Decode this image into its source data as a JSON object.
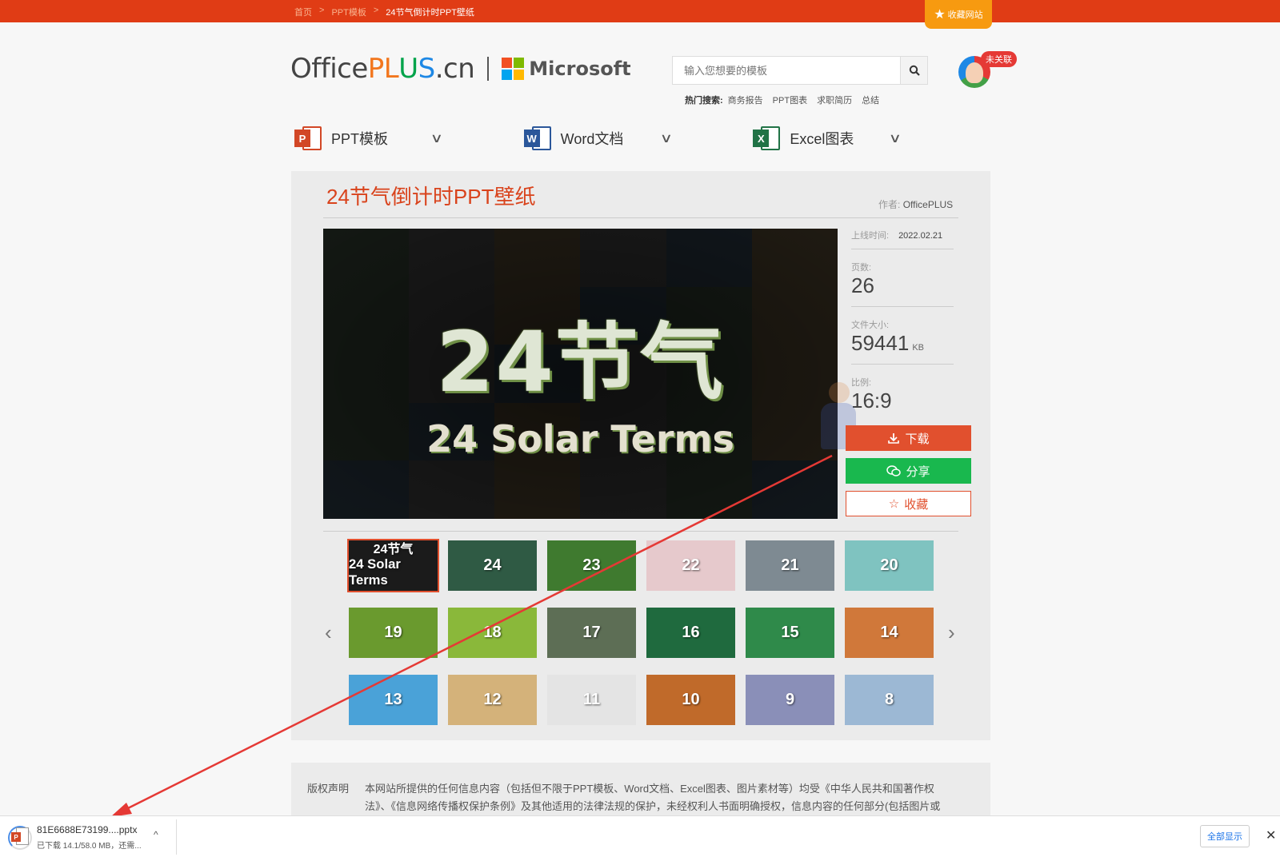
{
  "breadcrumb": {
    "home": "首页",
    "sep1": ">",
    "category": "PPT模板",
    "sep2": ">",
    "current": "24节气倒计时PPT壁纸"
  },
  "fav_site_label": "收藏网站",
  "logo": {
    "office": "Office",
    "plus_p": "P",
    "plus_l": "L",
    "u": "U",
    "s": "S",
    "domain": ".cn",
    "ms": "Microsoft"
  },
  "search": {
    "placeholder": "输入您想要的模板",
    "hot_label": "热门搜索:",
    "hot_terms": [
      "商务报告",
      "PPT图表",
      "求职简历",
      "总结"
    ]
  },
  "user": {
    "badge": "未关联"
  },
  "categories": [
    {
      "label": "PPT模板",
      "tag": "P",
      "color": "#d24726"
    },
    {
      "label": "Word文档",
      "tag": "W",
      "color": "#2b579a"
    },
    {
      "label": "Excel图表",
      "tag": "X",
      "color": "#217346"
    }
  ],
  "page": {
    "title": "24节气倒计时PPT壁纸",
    "author_label": "作者:",
    "author": "OfficePLUS",
    "preview_main": "24节气",
    "preview_sub": "24 Solar Terms"
  },
  "info": {
    "upload_label": "上线时间:",
    "upload_date": "2022.02.21",
    "pages_label": "页数:",
    "pages": "26",
    "size_label": "文件大小:",
    "size": "59441",
    "size_unit": "KB",
    "ratio_label": "比例:",
    "ratio": "16:9"
  },
  "buttons": {
    "download": "下载",
    "share": "分享",
    "favorite": "收藏"
  },
  "thumbnails": [
    {
      "label": "24节气",
      "sub": "24 Solar Terms",
      "color": "#1b1b1b"
    },
    {
      "label": "24",
      "color": "#2f5a44"
    },
    {
      "label": "23",
      "color": "#3f7a2f"
    },
    {
      "label": "22",
      "color": "#e6c9cc"
    },
    {
      "label": "21",
      "color": "#7e8a92"
    },
    {
      "label": "20",
      "color": "#7fc3c0"
    },
    {
      "label": "19",
      "color": "#6a9a2e"
    },
    {
      "label": "18",
      "color": "#8ab83a"
    },
    {
      "label": "17",
      "color": "#5d6e55"
    },
    {
      "label": "16",
      "color": "#1f6a3e"
    },
    {
      "label": "15",
      "color": "#2f8a4a"
    },
    {
      "label": "14",
      "color": "#d0783a"
    },
    {
      "label": "13",
      "color": "#4aa2d8"
    },
    {
      "label": "12",
      "color": "#d4b27a"
    },
    {
      "label": "11",
      "color": "#e4e4e4"
    },
    {
      "label": "10",
      "color": "#c06a2a"
    },
    {
      "label": "9",
      "color": "#8a8fb8"
    },
    {
      "label": "8",
      "color": "#9cb8d4"
    }
  ],
  "nav_arrows": {
    "prev": "‹",
    "next": "›"
  },
  "copyright": {
    "label": "版权声明",
    "text": "本网站所提供的任何信息内容（包括但不限于PPT模板、Word文档、Excel图表、图片素材等）均受《中华人民共和国著作权法》、《信息网络传播权保护条例》及其他适用的法律法规的保护，未经权利人书面明确授权，信息内容的任何部分(包括图片或"
  },
  "download_bar": {
    "filename": "81E6688E73199....pptx",
    "status": "已下载 14.1/58.0 MB，还需...",
    "caret": "^",
    "show_all": "全部显示",
    "close": "✕"
  },
  "colors": {
    "brand_red": "#e03c15",
    "download_btn": "#e1502e",
    "share_btn": "#19b84e",
    "title": "#d9431c",
    "annotation_arrow": "#e53935"
  },
  "icons": [
    "star-icon",
    "search-icon",
    "avatar-icon",
    "ppt-icon",
    "word-icon",
    "excel-icon",
    "chevron-down-icon",
    "download-icon",
    "wechat-icon",
    "star-outline-icon",
    "chevron-left-icon",
    "chevron-right-icon",
    "pptx-file-icon",
    "close-icon",
    "red-arrow-annotation"
  ]
}
